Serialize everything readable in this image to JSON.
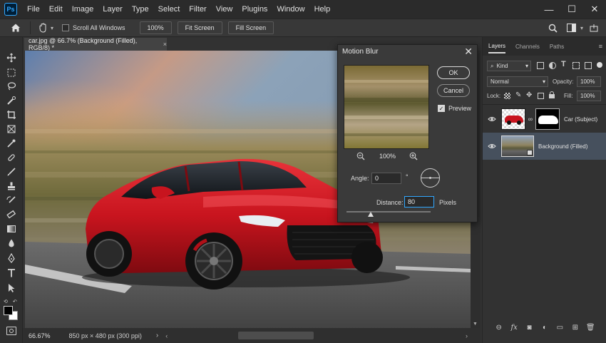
{
  "app": {
    "logo_text": "Ps"
  },
  "menu": [
    "File",
    "Edit",
    "Image",
    "Layer",
    "Type",
    "Select",
    "Filter",
    "View",
    "Plugins",
    "Window",
    "Help"
  ],
  "window_controls": {
    "minimize": "—",
    "maximize": "☐",
    "close": "✕"
  },
  "options_bar": {
    "scroll_all_windows": "Scroll All Windows",
    "zoom_value": "100%",
    "fit_screen": "Fit Screen",
    "fill_screen": "Fill Screen"
  },
  "document": {
    "tab_title": "car.jpg @ 66.7% (Background (Filled), RGB/8) *",
    "close_symbol": "×"
  },
  "status_bar": {
    "zoom": "66.67%",
    "doc_info": "850 px × 480 px (300 ppi)",
    "arrow": "›"
  },
  "dialog": {
    "title": "Motion Blur",
    "close_symbol": "✕",
    "ok": "OK",
    "cancel": "Cancel",
    "preview_label": "Preview",
    "preview_checked": true,
    "preview_zoom": "100%",
    "angle_label": "Angle:",
    "angle_value": "0",
    "angle_unit": "°",
    "distance_label": "Distance:",
    "distance_value": "80",
    "distance_unit": "Pixels"
  },
  "panels": {
    "tabs": [
      "Layers",
      "Channels",
      "Paths"
    ],
    "active_tab": "Layers",
    "kind_label": "Kind",
    "blend_mode": "Normal",
    "opacity_label": "Opacity:",
    "opacity_value": "100%",
    "lock_label": "Lock:",
    "fill_label": "Fill:",
    "fill_value": "100%",
    "layers": [
      {
        "name": "Car (Subject)",
        "selected": false
      },
      {
        "name": "Background (Filled)",
        "selected": true
      }
    ]
  },
  "colors": {
    "accent": "#31a8ff",
    "car_red": "#c8141e",
    "selected_layer": "#46505d"
  }
}
